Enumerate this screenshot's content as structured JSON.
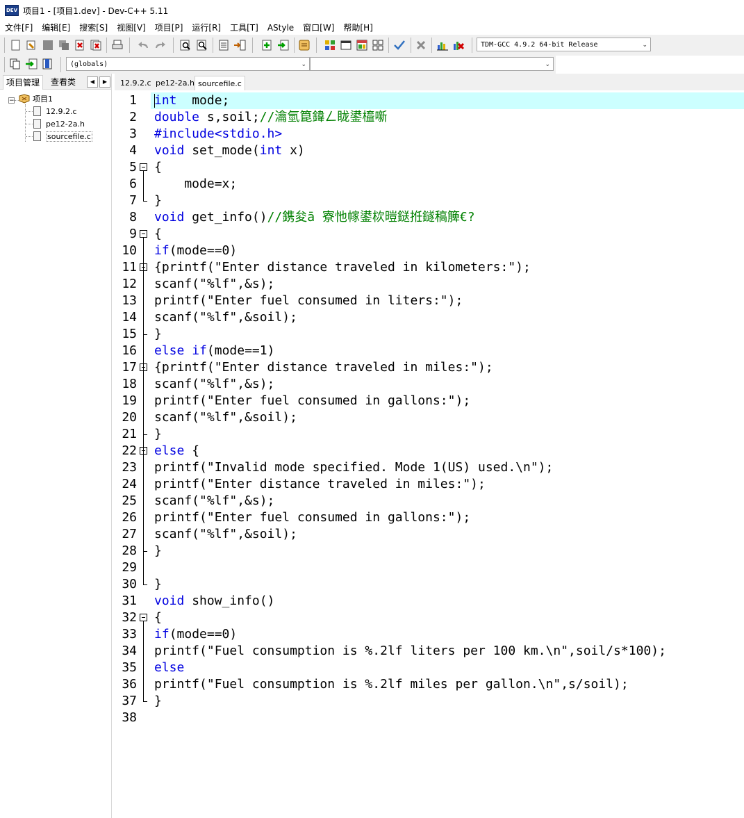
{
  "window": {
    "title": "项目1 - [项目1.dev] - Dev-C++ 5.11",
    "icon_label": "DEV"
  },
  "menu": [
    "文件[F]",
    "编辑[E]",
    "搜索[S]",
    "视图[V]",
    "项目[P]",
    "运行[R]",
    "工具[T]",
    "AStyle",
    "窗口[W]",
    "帮助[H]"
  ],
  "toolbar": {
    "compiler": "TDM-GCC 4.9.2 64-bit Release",
    "scope": "(globals)",
    "symbol": ""
  },
  "panel": {
    "tabs": [
      "项目管理",
      "查看类"
    ],
    "project": "项目1",
    "files": [
      "12.9.2.c",
      "pe12-2a.h",
      "sourcefile.c"
    ]
  },
  "editor_tabs": [
    "12.9.2.c",
    "pe12-2a.h",
    "sourcefile.c"
  ],
  "code_lines": [
    [
      [
        "kw",
        "int"
      ],
      [
        "",
        "  mode;"
      ]
    ],
    [
      [
        "kw",
        "double"
      ],
      [
        "",
        " s,soil;"
      ],
      [
        "cm",
        "//瀹氫箟鍏ㄥ眬鍙橀噺"
      ]
    ],
    [
      [
        "pp",
        "#include<stdio.h>"
      ]
    ],
    [
      [
        "kw",
        "void"
      ],
      [
        "",
        " set_mode("
      ],
      [
        "kw",
        "int"
      ],
      [
        "",
        " x)"
      ]
    ],
    [
      [
        "",
        "{"
      ]
    ],
    [
      [
        "",
        "    mode=x;"
      ]
    ],
    [
      [
        "",
        "}"
      ]
    ],
    [
      [
        "kw",
        "void"
      ],
      [
        "",
        " get_info()"
      ],
      [
        "cm",
        "//鎸夋ā 寮忚幏鍙栨暟鎹拰鐩稿簲€?"
      ]
    ],
    [
      [
        "",
        "{"
      ]
    ],
    [
      [
        "kw",
        "if"
      ],
      [
        "",
        "(mode==0)"
      ]
    ],
    [
      [
        "",
        "{printf(\"Enter distance traveled in kilometers:\");"
      ]
    ],
    [
      [
        "",
        "scanf(\"%lf\",&s);"
      ]
    ],
    [
      [
        "",
        "printf(\"Enter fuel consumed in liters:\");"
      ]
    ],
    [
      [
        "",
        "scanf(\"%lf\",&soil);"
      ]
    ],
    [
      [
        "",
        "}"
      ]
    ],
    [
      [
        "kw",
        "else"
      ],
      [
        "",
        " "
      ],
      [
        "kw",
        "if"
      ],
      [
        "",
        "(mode==1)"
      ]
    ],
    [
      [
        "",
        "{printf(\"Enter distance traveled in miles:\");"
      ]
    ],
    [
      [
        "",
        "scanf(\"%lf\",&s);"
      ]
    ],
    [
      [
        "",
        "printf(\"Enter fuel consumed in gallons:\");"
      ]
    ],
    [
      [
        "",
        "scanf(\"%lf\",&soil);"
      ]
    ],
    [
      [
        "",
        "}"
      ]
    ],
    [
      [
        "kw",
        "else"
      ],
      [
        "",
        " {"
      ]
    ],
    [
      [
        "",
        "printf(\"Invalid mode specified. Mode 1(US) used.\\n\");"
      ]
    ],
    [
      [
        "",
        "printf(\"Enter distance traveled in miles:\");"
      ]
    ],
    [
      [
        "",
        "scanf(\"%lf\",&s);"
      ]
    ],
    [
      [
        "",
        "printf(\"Enter fuel consumed in gallons:\");"
      ]
    ],
    [
      [
        "",
        "scanf(\"%lf\",&soil);"
      ]
    ],
    [
      [
        "",
        "}"
      ]
    ],
    [
      [
        "",
        ""
      ]
    ],
    [
      [
        "",
        "}"
      ]
    ],
    [
      [
        "kw",
        "void"
      ],
      [
        "",
        " show_info()"
      ]
    ],
    [
      [
        "",
        "{"
      ]
    ],
    [
      [
        "kw",
        "if"
      ],
      [
        "",
        "(mode==0)"
      ]
    ],
    [
      [
        "",
        "printf(\"Fuel consumption is %.2lf liters per 100 km.\\n\",soil/s*100);"
      ]
    ],
    [
      [
        "kw",
        "else"
      ]
    ],
    [
      [
        "",
        "printf(\"Fuel consumption is %.2lf miles per gallon.\\n\",s/soil);"
      ]
    ],
    [
      [
        "",
        "}"
      ]
    ],
    [
      [
        "",
        ""
      ]
    ]
  ],
  "fold_open_lines": [
    5,
    9,
    11,
    17,
    22,
    32
  ],
  "fold_end_lines": [
    7,
    15,
    21,
    28,
    30,
    37
  ],
  "colors": {
    "keyword": "#0000e0",
    "comment": "#008000",
    "current_line": "#ccffff"
  }
}
